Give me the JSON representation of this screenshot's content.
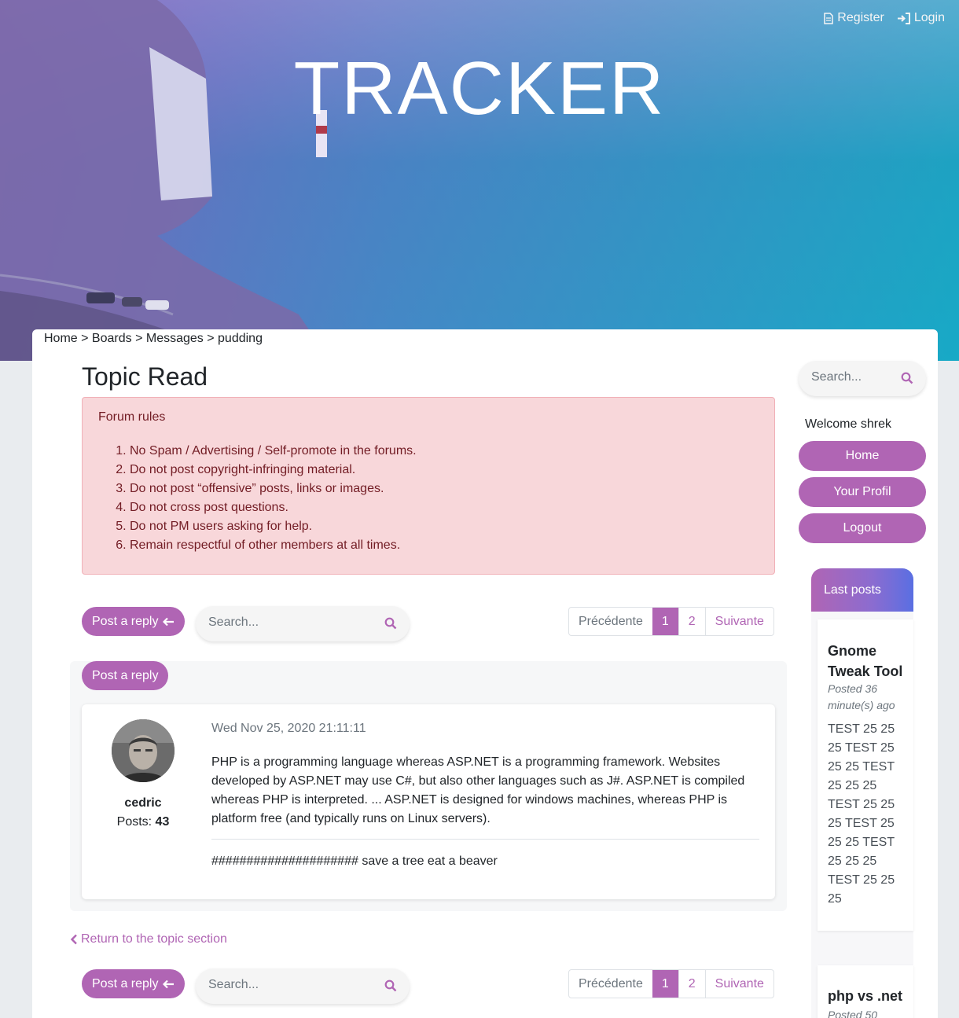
{
  "header": {
    "site_title": "TRACKER",
    "register_label": "Register",
    "login_label": "Login"
  },
  "breadcrumb": {
    "home": "Home",
    "sep1": " > ",
    "boards": "Boards",
    "sep2": " > ",
    "messages": "Messages",
    "sep3": " > ",
    "current": "pudding"
  },
  "page_title": "Topic Read",
  "rules": {
    "title": "Forum rules",
    "items": [
      "No Spam / Advertising / Self-promote in the forums.",
      "Do not post copyright-infringing material.",
      "Do not post “offensive” posts, links or images.",
      "Do not cross post questions.",
      "Do not PM users asking for help.",
      "Remain respectful of other members at all times."
    ]
  },
  "toolbar": {
    "post_reply_label": "Post a reply",
    "search_placeholder": "Search..."
  },
  "pagination": {
    "prev": "Précédente",
    "pages": [
      "1",
      "2"
    ],
    "next": "Suivante",
    "active_page": "1"
  },
  "post": {
    "reply_label": "Post a reply",
    "author": "cedric",
    "posts_label": "Posts: ",
    "posts_count": "43",
    "date": "Wed Nov 25, 2020 21:11:11",
    "body": "PHP is a programming language whereas ASP.NET is a programming framework. Websites developed by ASP.NET may use C#, but also other languages such as J#. ASP.NET is compiled whereas PHP is interpreted. ... ASP.NET is designed for windows machines, whereas PHP is platform free (and typically runs on Linux servers).",
    "signature": "##################### save a tree eat a beaver"
  },
  "return_link": "Return to the topic section",
  "sidebar": {
    "search_placeholder": "Search...",
    "welcome": "Welcome shrek",
    "buttons": {
      "home": "Home",
      "profile": "Your Profil",
      "logout": "Logout"
    },
    "last_posts_title": "Last posts",
    "last_posts": [
      {
        "title_line1": "Gnome",
        "title_line2": "Tweak Tool",
        "meta_line1": "Posted 36",
        "meta_line2": "minute(s) ago",
        "text_lines": [
          "TEST 25 25",
          "25 TEST 25",
          "25 25 TEST",
          "25 25 25",
          "TEST 25 25",
          "25 TEST 25",
          "25 25 TEST",
          "25 25 25",
          "TEST 25 25",
          "25"
        ]
      },
      {
        "title_line1": "php vs .net",
        "meta_line1": "Posted 50"
      }
    ]
  },
  "colors": {
    "accent": "#b065b4",
    "alert_bg": "#f8d7da",
    "alert_text": "#721c24"
  }
}
